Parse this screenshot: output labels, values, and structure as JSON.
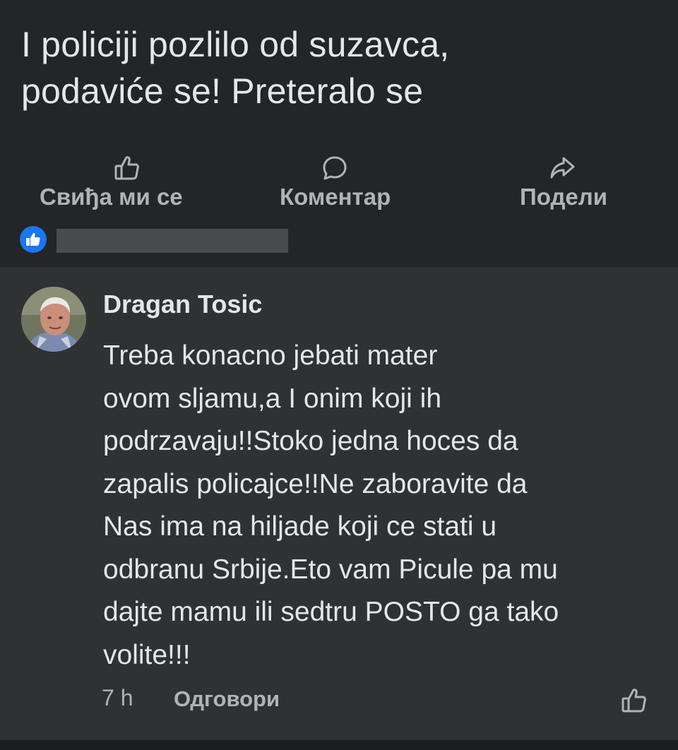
{
  "post": {
    "text": "I policiji pozlilo od suzavca,\npodaviće se! Preteralo se"
  },
  "actions": {
    "like_label": "Свиђа ми се",
    "comment_label": "Коментар",
    "share_label": "Подели"
  },
  "comment": {
    "author": "Dragan Tosic",
    "text": "Treba konacno jebati mater\n ovom sljamu,a I onim koji ih\npodrzavaju!!Stoko jedna hoces da\nzapalis policajce!!Ne zaboravite da\nNas ima na hiljade koji ce stati u\nodbranu Srbije.Eto vam Picule pa mu\ndajte mamu ili sedtru POSTO ga tako\nvolite!!!",
    "time": "7 h",
    "reply_label": "Одговори"
  },
  "colors": {
    "post_bg": "#242526",
    "comment_bg": "#303133",
    "text_primary": "#e4e6eb",
    "text_secondary": "#b0b3b8",
    "like_blue": "#1877f2"
  },
  "icons": [
    "thumbs-up-icon",
    "comment-bubble-icon",
    "share-arrow-icon",
    "like-badge-icon"
  ]
}
